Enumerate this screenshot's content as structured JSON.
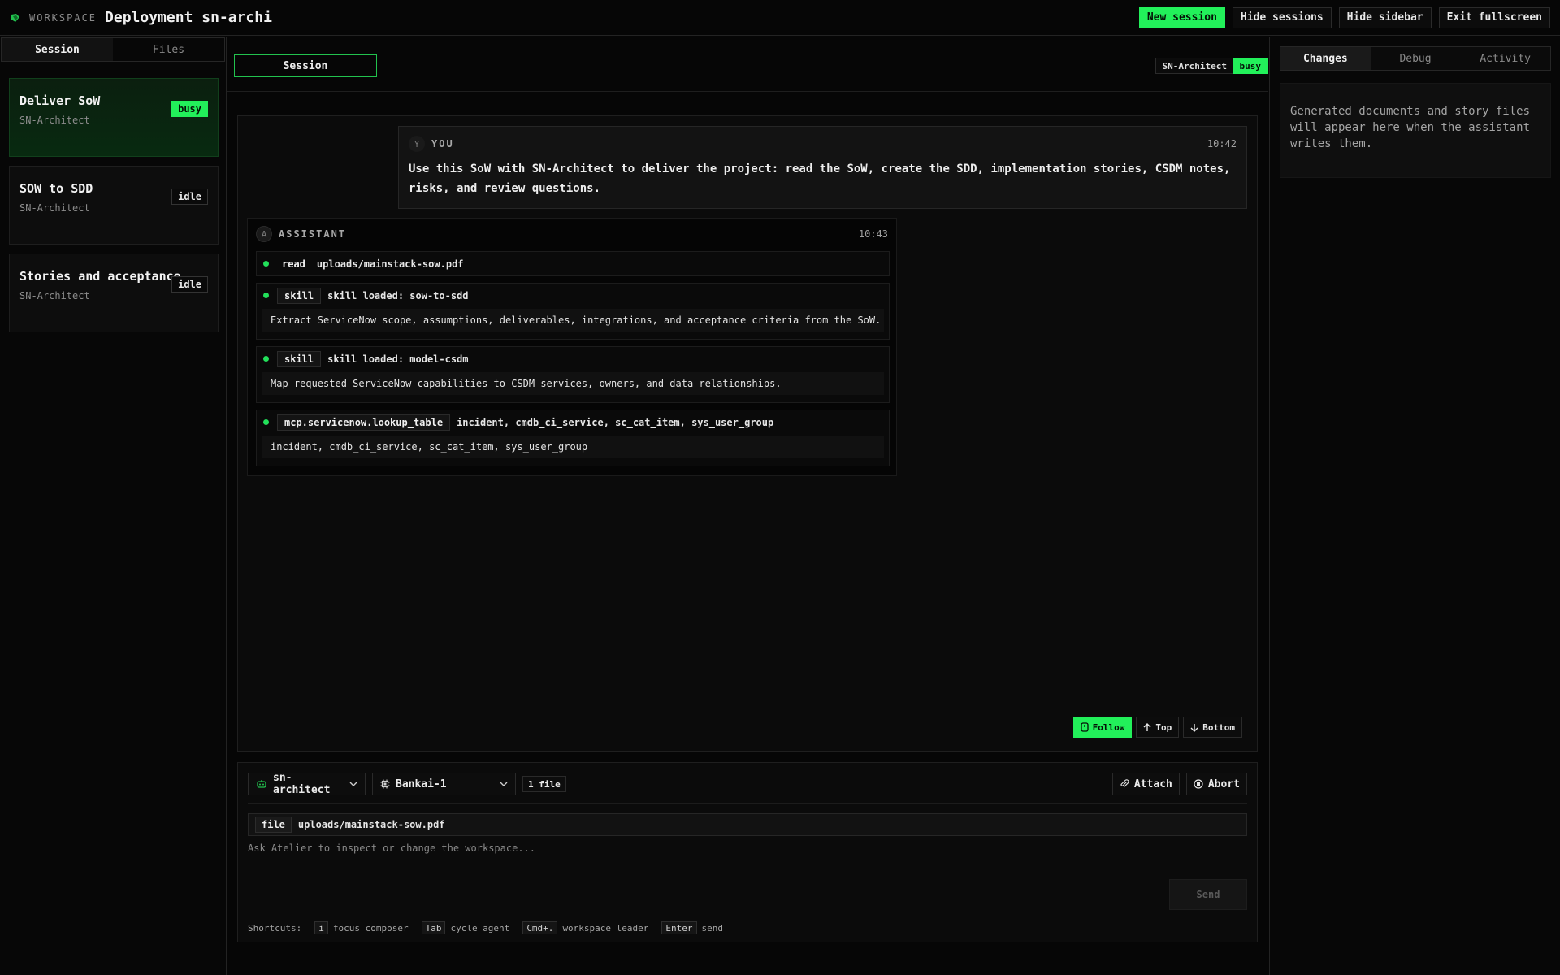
{
  "topbar": {
    "workspace_label": "WORKSPACE",
    "title": "Deployment sn-archi",
    "buttons": {
      "new_session": "New session",
      "hide_sessions": "Hide sessions",
      "hide_sidebar": "Hide sidebar",
      "exit_fullscreen": "Exit fullscreen"
    }
  },
  "sidebar": {
    "tabs": [
      "Session",
      "Files"
    ],
    "sessions": [
      {
        "title": "Deliver SoW",
        "agent": "SN-Architect",
        "status": "busy"
      },
      {
        "title": "SOW to SDD",
        "agent": "SN-Architect",
        "status": "idle"
      },
      {
        "title": "Stories and acceptance",
        "agent": "SN-Architect",
        "status": "idle"
      }
    ]
  },
  "center": {
    "session_tab": "Session",
    "agent_name": "SN-Architect",
    "agent_status": "busy"
  },
  "chat": {
    "user": {
      "avatar": "Y",
      "role": "YOU",
      "time": "10:42",
      "text": "Use this SoW with SN-Architect to deliver the project: read the SoW, create the SDD, implementation stories, CSDM notes, risks, and review questions."
    },
    "assistant": {
      "avatar": "A",
      "role": "ASSISTANT",
      "time": "10:43",
      "tools": [
        {
          "tag": "read",
          "arg": "uploads/mainstack-sow.pdf"
        },
        {
          "tag": "skill",
          "arg": "skill loaded: sow-to-sdd",
          "body": "Extract ServiceNow scope, assumptions, deliverables, integrations, and acceptance criteria from the SoW."
        },
        {
          "tag": "skill",
          "arg": "skill loaded: model-csdm",
          "body": "Map requested ServiceNow capabilities to CSDM services, owners, and data relationships."
        },
        {
          "tag": "mcp.servicenow.lookup_table",
          "arg": "incident, cmdb_ci_service, sc_cat_item, sys_user_group",
          "body": "incident, cmdb_ci_service, sc_cat_item, sys_user_group"
        }
      ]
    },
    "scroll": {
      "follow": "Follow",
      "top": "Top",
      "bottom": "Bottom"
    }
  },
  "composer": {
    "agent_select": "sn-architect",
    "model_select": "Bankai-1",
    "files_count": "1 file",
    "attach": "Attach",
    "abort": "Abort",
    "file_tag": "file",
    "file_path": "uploads/mainstack-sow.pdf",
    "placeholder": "Ask Atelier to inspect or change the workspace...",
    "send": "Send",
    "shortcuts": {
      "label": "Shortcuts:",
      "items": [
        {
          "key": "i",
          "desc": "focus composer"
        },
        {
          "key": "Tab",
          "desc": "cycle agent"
        },
        {
          "key": "Cmd+.",
          "desc": "workspace leader"
        },
        {
          "key": "Enter",
          "desc": "send"
        }
      ]
    }
  },
  "right_panel": {
    "tabs": [
      "Changes",
      "Debug",
      "Activity"
    ],
    "empty_text": "Generated documents and story files will appear here when the assistant writes them."
  },
  "colors": {
    "accent": "#22f05a",
    "background": "#060606",
    "panel": "#0b0b0b"
  }
}
